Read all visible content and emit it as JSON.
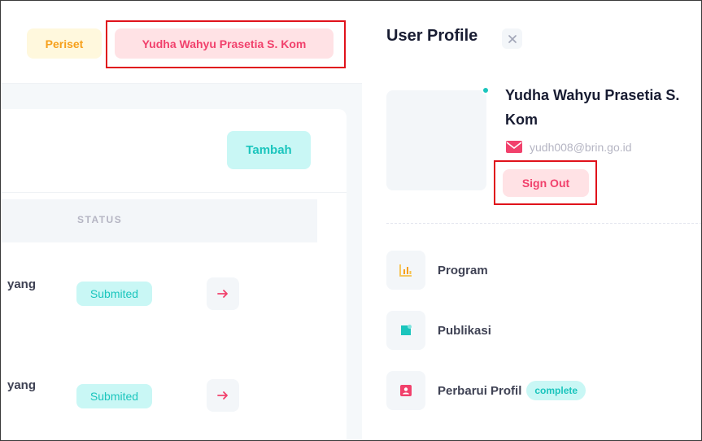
{
  "header": {
    "role_badge": "Periset",
    "user_badge": "Yudha Wahyu Prasetia S. Kom"
  },
  "table": {
    "add_button": "Tambah",
    "status_header": "STATUS",
    "rows": [
      {
        "title_fragment": "yang",
        "status": "Submited"
      },
      {
        "title_fragment": "yang",
        "status": "Submited"
      }
    ]
  },
  "profile": {
    "title": "User Profile",
    "name": "Yudha Wahyu Prasetia S. Kom",
    "email": "yudh008@brin.go.id",
    "sign_out": "Sign Out",
    "menu": [
      {
        "label": "Program",
        "icon": "chart-icon"
      },
      {
        "label": "Publikasi",
        "icon": "document-icon"
      },
      {
        "label": "Perbarui Profil",
        "icon": "user-icon",
        "badge": "complete"
      }
    ]
  },
  "colors": {
    "primary": "#1bc5bd",
    "danger": "#f1416c",
    "warning": "#f6a01b",
    "annotation": "#e0121b"
  }
}
